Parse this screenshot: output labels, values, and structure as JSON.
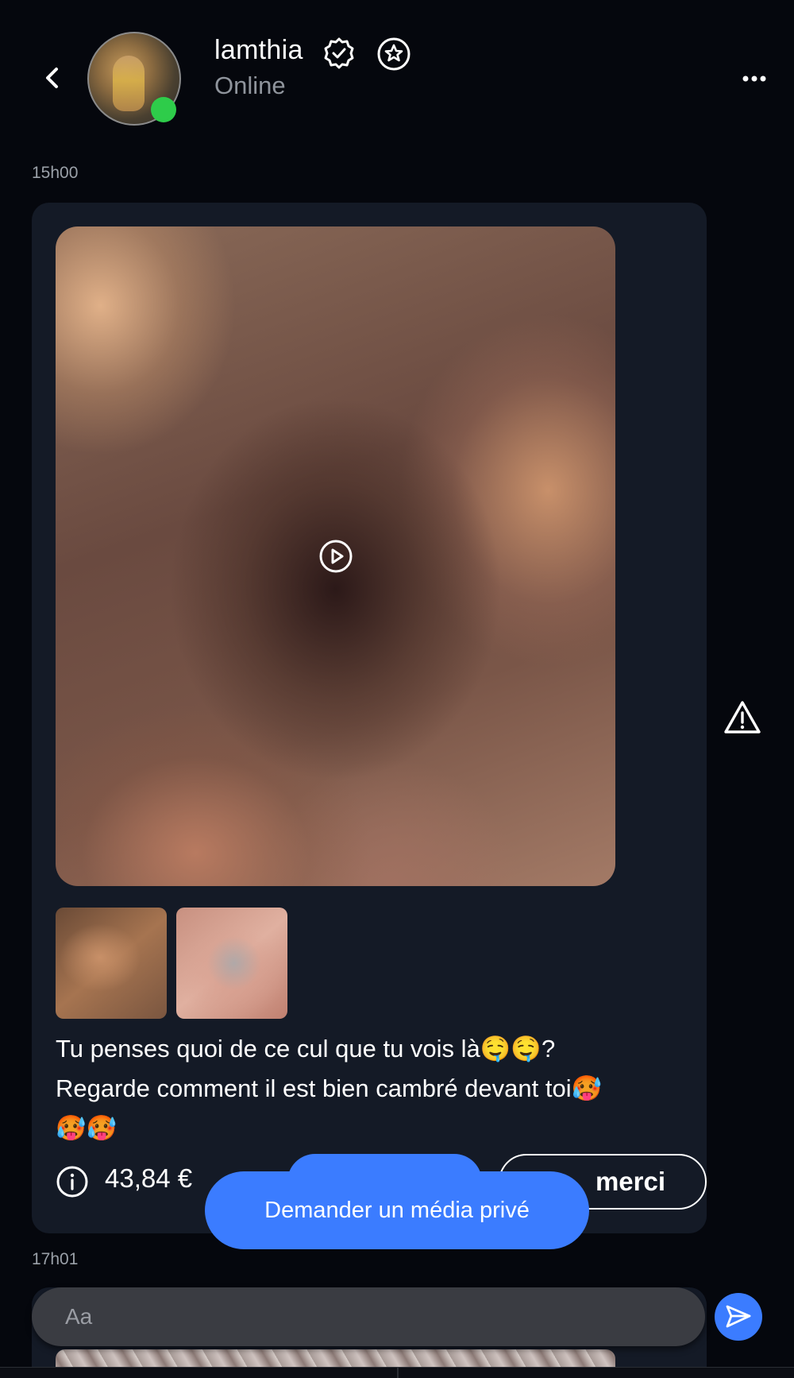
{
  "header": {
    "username": "lamthia",
    "status": "Online"
  },
  "messages": [
    {
      "timestamp": "15h00",
      "caption_line1": "Tu penses quoi de ce cul que tu vois là🤤🤤?",
      "caption_line2": "Regarde comment il est bien cambré devant toi🥵",
      "caption_line3": "🥵🥵",
      "price": "43,84 €",
      "thanks_label": "merci"
    },
    {
      "timestamp": "17h01"
    }
  ],
  "overlay": {
    "private_media_label": "Demander un média privé"
  },
  "composer": {
    "placeholder": "Aa"
  },
  "colors": {
    "background": "#05070d",
    "card": "#141a26",
    "accent": "#3b7cff",
    "online": "#2ecc4a"
  },
  "icons": [
    "back-arrow-icon",
    "verified-icon",
    "star-icon",
    "more-icon",
    "play-icon",
    "info-icon",
    "warning-icon",
    "send-icon"
  ]
}
